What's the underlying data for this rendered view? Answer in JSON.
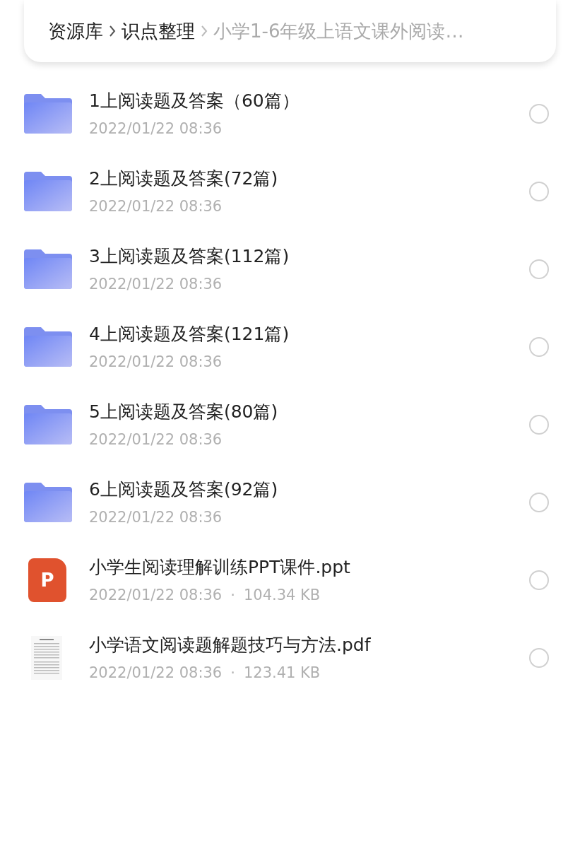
{
  "breadcrumb": {
    "items": [
      {
        "label": "资源库",
        "current": false
      },
      {
        "label": "识点整理",
        "current": false
      },
      {
        "label": "小学1-6年级上语文课外阅读…",
        "current": true
      }
    ]
  },
  "files": [
    {
      "kind": "folder",
      "name": "1上阅读题及答案（60篇）",
      "date": "2022/01/22 08:36",
      "selected": false
    },
    {
      "kind": "folder",
      "name": "2上阅读题及答案(72篇)",
      "date": "2022/01/22 08:36",
      "selected": false
    },
    {
      "kind": "folder",
      "name": "3上阅读题及答案(112篇)",
      "date": "2022/01/22 08:36",
      "selected": false
    },
    {
      "kind": "folder",
      "name": "4上阅读题及答案(121篇)",
      "date": "2022/01/22 08:36",
      "selected": false
    },
    {
      "kind": "folder",
      "name": "5上阅读题及答案(80篇)",
      "date": "2022/01/22 08:36",
      "selected": false
    },
    {
      "kind": "folder",
      "name": "6上阅读题及答案(92篇)",
      "date": "2022/01/22 08:36",
      "selected": false
    },
    {
      "kind": "ppt",
      "badge": "P",
      "name": "小学生阅读理解训练PPT课件.ppt",
      "date": "2022/01/22 08:36",
      "separator": "·",
      "size": "104.34 KB",
      "selected": false
    },
    {
      "kind": "pdf",
      "name": "小学语文阅读题解题技巧与方法.pdf",
      "date": "2022/01/22 08:36",
      "separator": "·",
      "size": "123.41 KB",
      "selected": false
    }
  ]
}
